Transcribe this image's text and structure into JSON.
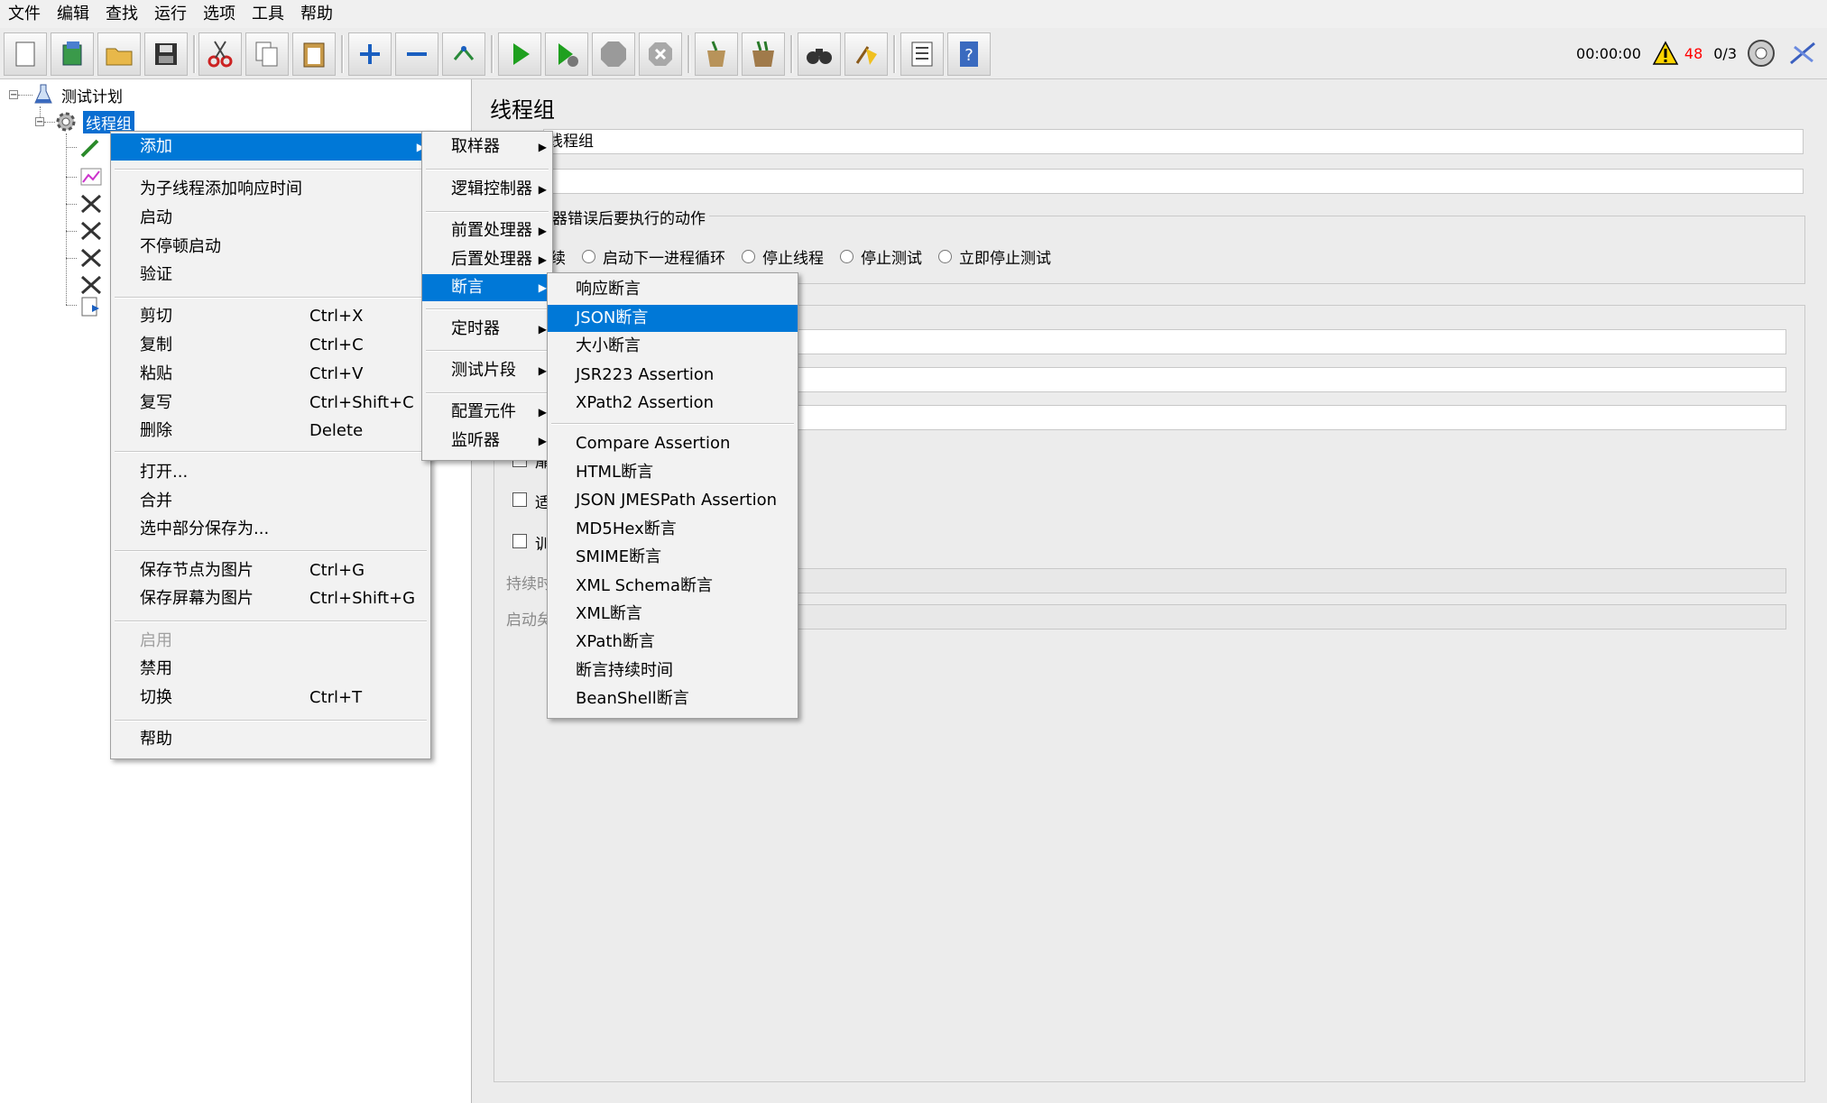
{
  "menubar": {
    "items": [
      "文件",
      "编辑",
      "查找",
      "运行",
      "选项",
      "工具",
      "帮助"
    ]
  },
  "toolbar": {
    "buttons": [
      "new-icon",
      "templates-icon",
      "open-icon",
      "save-icon",
      "cut-icon",
      "copy-icon",
      "paste-icon",
      "expand-icon",
      "collapse-icon",
      "toggle-icon",
      "start-icon",
      "start-no-pause-icon",
      "stop-icon",
      "shutdown-icon",
      "clear-icon",
      "clear-all-icon",
      "search-icon",
      "reset-search-icon",
      "function-helper-icon",
      "help-icon"
    ],
    "timer": "00:00:00",
    "warning_count": "48",
    "threads": "0/3"
  },
  "tree": {
    "test_plan": "测试计划",
    "thread_group": "线程组"
  },
  "right": {
    "title": "线程组",
    "name_value": "线程组",
    "on_error_legend": "器错误后要执行的动作",
    "on_error_options": [
      "续",
      "启动下一进程循环",
      "停止线程",
      "停止测试",
      "立即停止测试"
    ],
    "duration_label": "持续时",
    "startup_delay_label": "启动矣",
    "cb1_label": "适",
    "cb2_label": "训",
    "cb0_label": "扉"
  },
  "context_menu": {
    "add": "添加",
    "items1": [
      "为子线程添加响应时间",
      "启动",
      "不停顿启动",
      "验证"
    ],
    "edit_items": [
      {
        "label": "剪切",
        "shortcut": "Ctrl+X"
      },
      {
        "label": "复制",
        "shortcut": "Ctrl+C"
      },
      {
        "label": "粘贴",
        "shortcut": "Ctrl+V"
      },
      {
        "label": "复写",
        "shortcut": "Ctrl+Shift+C"
      },
      {
        "label": "删除",
        "shortcut": "Delete"
      }
    ],
    "file_items": [
      "打开...",
      "合并",
      "选中部分保存为..."
    ],
    "image_items": [
      {
        "label": "保存节点为图片",
        "shortcut": "Ctrl+G"
      },
      {
        "label": "保存屏幕为图片",
        "shortcut": "Ctrl+Shift+G"
      }
    ],
    "enable": "启用",
    "disable": "禁用",
    "toggle": {
      "label": "切换",
      "shortcut": "Ctrl+T"
    },
    "help": "帮助"
  },
  "add_submenu": [
    "取样器",
    "逻辑控制器",
    "前置处理器",
    "后置处理器",
    "断言",
    "定时器",
    "测试片段",
    "配置元件",
    "监听器"
  ],
  "assertion_submenu": {
    "group1": [
      "响应断言",
      "JSON断言",
      "大小断言",
      "JSR223 Assertion",
      "XPath2 Assertion"
    ],
    "group2": [
      "Compare Assertion",
      "HTML断言",
      "JSON JMESPath Assertion",
      "MD5Hex断言",
      "SMIME断言",
      "XML Schema断言",
      "XML断言",
      "XPath断言",
      "断言持续时间",
      "BeanShell断言"
    ]
  },
  "colors": {
    "highlight": "#0078d7",
    "warning": "#ff0000"
  }
}
